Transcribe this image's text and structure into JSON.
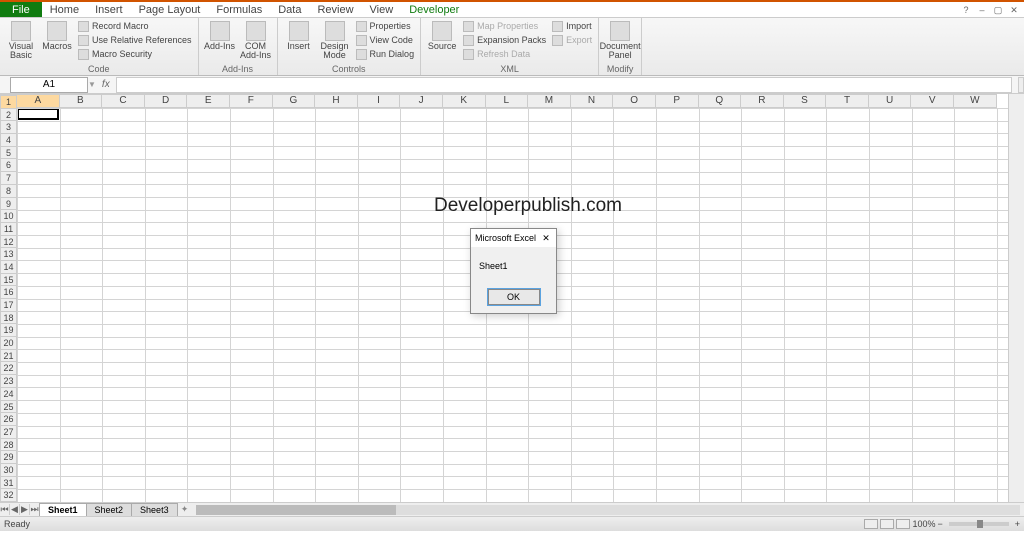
{
  "tabs": [
    "File",
    "Home",
    "Insert",
    "Page Layout",
    "Formulas",
    "Data",
    "Review",
    "View",
    "Developer"
  ],
  "active_tab": "Developer",
  "ribbon": {
    "code": {
      "vb": "Visual\nBasic",
      "macros": "Macros",
      "record": "Record Macro",
      "relref": "Use Relative References",
      "security": "Macro Security",
      "label": "Code"
    },
    "addins": {
      "addins": "Add-Ins",
      "com": "COM\nAdd-Ins",
      "label": "Add-Ins"
    },
    "controls": {
      "insert": "Insert",
      "design": "Design\nMode",
      "props": "Properties",
      "viewcode": "View Code",
      "rundlg": "Run Dialog",
      "label": "Controls"
    },
    "xml": {
      "source": "Source",
      "mapprops": "Map Properties",
      "expansion": "Expansion Packs",
      "refresh": "Refresh Data",
      "import": "Import",
      "export": "Export",
      "label": "XML"
    },
    "modify": {
      "docpanel": "Document\nPanel",
      "label": "Modify"
    }
  },
  "namebox": "A1",
  "fx": "fx",
  "columns": [
    "A",
    "B",
    "C",
    "D",
    "E",
    "F",
    "G",
    "H",
    "I",
    "J",
    "K",
    "L",
    "M",
    "N",
    "O",
    "P",
    "Q",
    "R",
    "S",
    "T",
    "U",
    "V",
    "W"
  ],
  "rows": [
    1,
    2,
    3,
    4,
    5,
    6,
    7,
    8,
    9,
    10,
    11,
    12,
    13,
    14,
    15,
    16,
    17,
    18,
    19,
    20,
    21,
    22,
    23,
    24,
    25,
    26,
    27,
    28,
    29,
    30,
    31,
    32
  ],
  "overlay": "Developerpublish.com",
  "dialog": {
    "title": "Microsoft Excel",
    "body": "Sheet1",
    "ok": "OK"
  },
  "sheets": [
    "Sheet1",
    "Sheet2",
    "Sheet3"
  ],
  "active_sheet": "Sheet1",
  "status": {
    "ready": "Ready",
    "zoom": "100%"
  }
}
